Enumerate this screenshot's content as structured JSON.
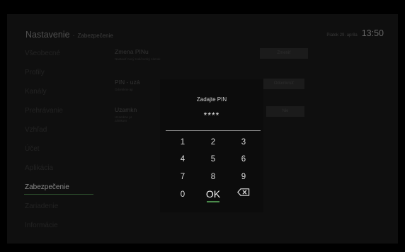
{
  "header": {
    "title": "Nastavenie",
    "separator": "·",
    "subtitle": "Zabezpečenie",
    "date": "Piatok 29. apríla",
    "time": "13:50"
  },
  "sidebar": {
    "items": [
      {
        "label": "Všeobecné"
      },
      {
        "label": "Profily"
      },
      {
        "label": "Kanály"
      },
      {
        "label": "Prehrávanie"
      },
      {
        "label": "Vzhľad"
      },
      {
        "label": "Účet"
      },
      {
        "label": "Aplikácia"
      },
      {
        "label": "Zabezpečenie"
      },
      {
        "label": "Zariadenie"
      },
      {
        "label": "Informácie"
      }
    ],
    "active_index": 7
  },
  "settings": [
    {
      "title": "Zmena PINu",
      "desc": "Nastaviť nový rodičovský zámok",
      "button": "Zmeniť"
    },
    {
      "title": "PIN - uzá",
      "desc": "Odomkne ap",
      "button": "Odomknúť"
    },
    {
      "title": "Uzamkn",
      "desc": "Uzamkne pr\nzámkom",
      "button": "Nie"
    }
  ],
  "dialog": {
    "title": "Zadajte PIN",
    "pin_value": "****",
    "keys": [
      "1",
      "2",
      "3",
      "4",
      "5",
      "6",
      "7",
      "8",
      "9",
      "0",
      "OK"
    ],
    "backspace_icon": "backspace-icon"
  },
  "colors": {
    "accent": "#4b8a4b",
    "background": "#141414",
    "dialog": "#0c0c0c"
  }
}
